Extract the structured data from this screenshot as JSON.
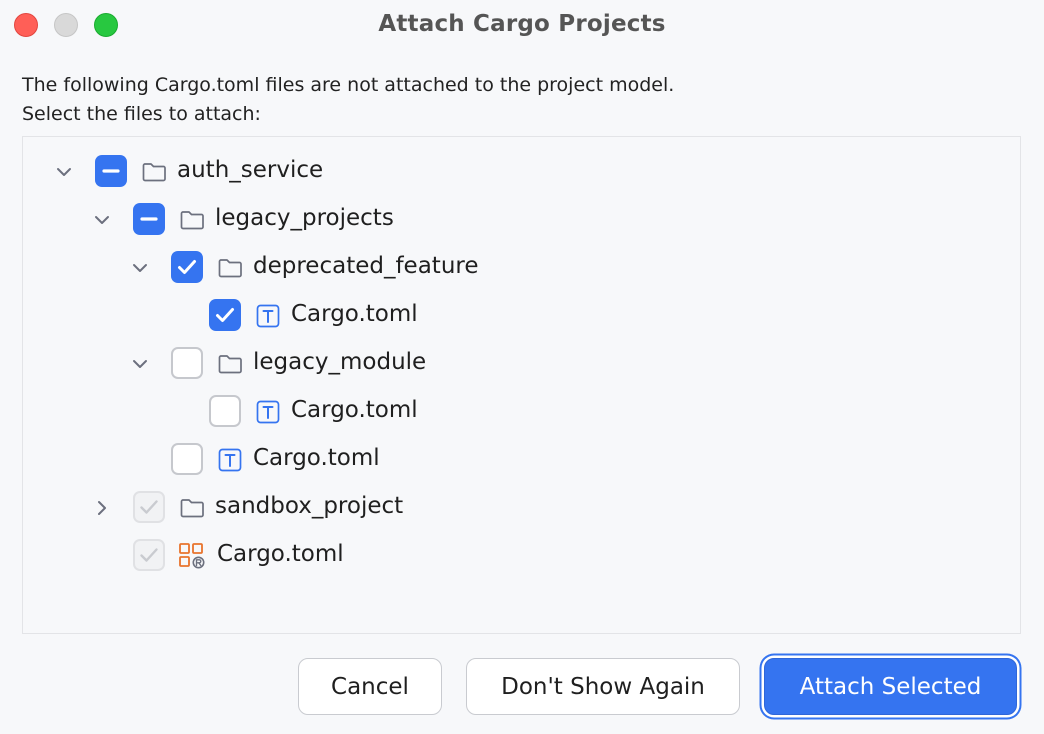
{
  "window": {
    "title": "Attach Cargo Projects"
  },
  "description": {
    "line1": "The following Cargo.toml files are not attached to the project model.",
    "line2": "Select the files to attach:"
  },
  "tree": {
    "items": [
      {
        "label": "auth_service",
        "icon": "folder-icon",
        "checkbox": "partial",
        "expander": "expanded"
      },
      {
        "label": "legacy_projects",
        "icon": "folder-icon",
        "checkbox": "partial",
        "expander": "expanded"
      },
      {
        "label": "deprecated_feature",
        "icon": "folder-icon",
        "checkbox": "checked",
        "expander": "expanded"
      },
      {
        "label": "Cargo.toml",
        "icon": "toml-file-icon",
        "checkbox": "checked",
        "expander": "none"
      },
      {
        "label": "legacy_module",
        "icon": "folder-icon",
        "checkbox": "unchecked",
        "expander": "expanded"
      },
      {
        "label": "Cargo.toml",
        "icon": "toml-file-icon",
        "checkbox": "unchecked",
        "expander": "none"
      },
      {
        "label": "Cargo.toml",
        "icon": "toml-file-icon",
        "checkbox": "unchecked",
        "expander": "none"
      },
      {
        "label": "sandbox_project",
        "icon": "folder-icon",
        "checkbox": "disabled-checked",
        "expander": "collapsed"
      },
      {
        "label": "Cargo.toml",
        "icon": "cargo-project-icon",
        "checkbox": "disabled-checked",
        "expander": "none"
      }
    ]
  },
  "buttons": {
    "cancel": "Cancel",
    "dont_show_again": "Don't Show Again",
    "attach_selected": "Attach Selected"
  },
  "colors": {
    "accent": "#3574f0",
    "close": "#ff5f57",
    "minimize": "#d9d9d9",
    "maximize": "#28c840",
    "cargo_icon": "#e8732c",
    "toml_icon": "#3574f0"
  }
}
